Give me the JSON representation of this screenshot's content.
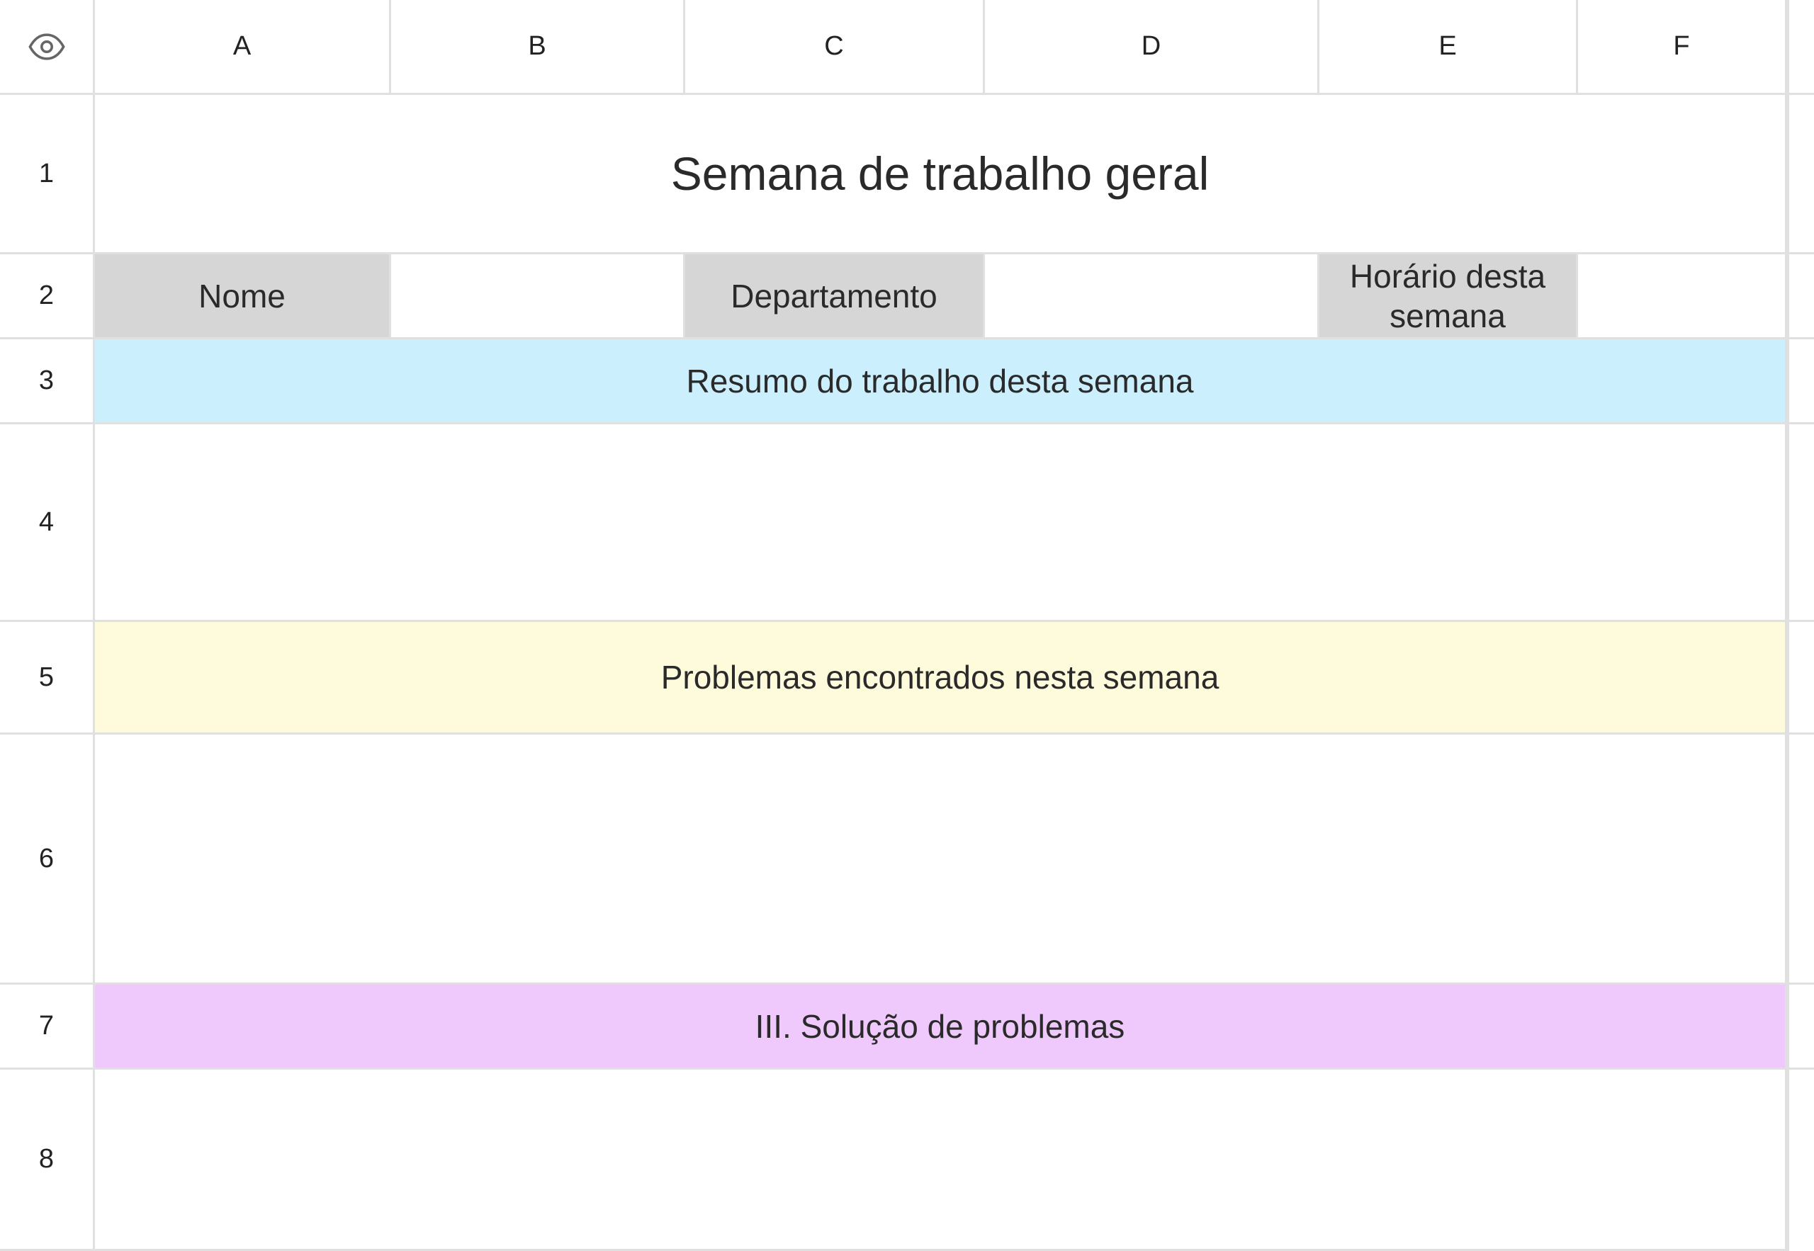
{
  "columns": [
    "A",
    "B",
    "C",
    "D",
    "E",
    "F"
  ],
  "rows": [
    "1",
    "2",
    "3",
    "4",
    "5",
    "6",
    "7",
    "8"
  ],
  "corner_icon": "eye-icon",
  "title": "Semana de trabalho geral",
  "row2": {
    "nome_label": "Nome",
    "nome_value": "",
    "departamento_label": "Departamento",
    "departamento_value": "",
    "horario_label": "Horário desta semana",
    "horario_value": ""
  },
  "sections": {
    "resumo": "Resumo do trabalho desta semana",
    "resumo_body": "",
    "problemas": "Problemas encontrados nesta semana",
    "problemas_body": "",
    "solucao": "III. Solução de problemas",
    "solucao_body": ""
  },
  "colors": {
    "header_grey": "#d6d6d6",
    "section_blue": "#cbeffc",
    "section_yellow": "#fefadc",
    "section_purple": "#efc9fb",
    "grid_line": "#e0e0e0"
  }
}
